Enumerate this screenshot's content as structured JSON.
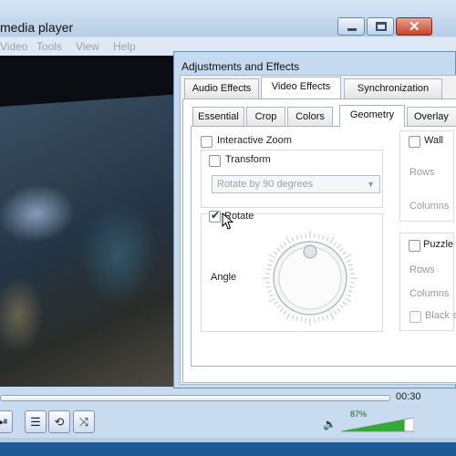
{
  "main_window": {
    "title": "media player",
    "menu": [
      "Video",
      "Tools",
      "View",
      "Help"
    ],
    "seek": {
      "total_time": "00:30"
    },
    "controls": {
      "frame_btn": "⏯",
      "playlist_btn": "☰",
      "loop_btn": "⟲",
      "shuffle_btn": "⤨"
    },
    "volume": {
      "percent_label": "87%",
      "level": 0.87
    }
  },
  "dialog": {
    "title": "Adjustments and Effects",
    "tabs": [
      {
        "label": "Audio Effects",
        "active": false
      },
      {
        "label": "Video Effects",
        "active": true
      },
      {
        "label": "Synchronization",
        "active": false
      }
    ],
    "subtabs": [
      {
        "label": "Essential",
        "active": false
      },
      {
        "label": "Crop",
        "active": false
      },
      {
        "label": "Colors",
        "active": false
      },
      {
        "label": "Geometry",
        "active": true
      },
      {
        "label": "Overlay",
        "active": false
      }
    ],
    "geometry": {
      "interactive_zoom": {
        "label": "Interactive Zoom",
        "checked": false
      },
      "transform": {
        "label": "Transform",
        "checked": false,
        "select_value": "Rotate by 90 degrees"
      },
      "rotate": {
        "label": "Rotate",
        "checked": true,
        "angle_label": "Angle"
      },
      "wall": {
        "label": "Wall",
        "checked": false,
        "rows_label": "Rows",
        "columns_label": "Columns"
      },
      "puzzle": {
        "label": "Puzzle g",
        "checked": false,
        "rows_label": "Rows",
        "columns_label": "Columns",
        "black_label": "Black sl"
      }
    }
  },
  "colors": {
    "titlebar": "#c6daf0",
    "accent_green": "#2e9a2e",
    "taskbar": "#1c5a95"
  }
}
